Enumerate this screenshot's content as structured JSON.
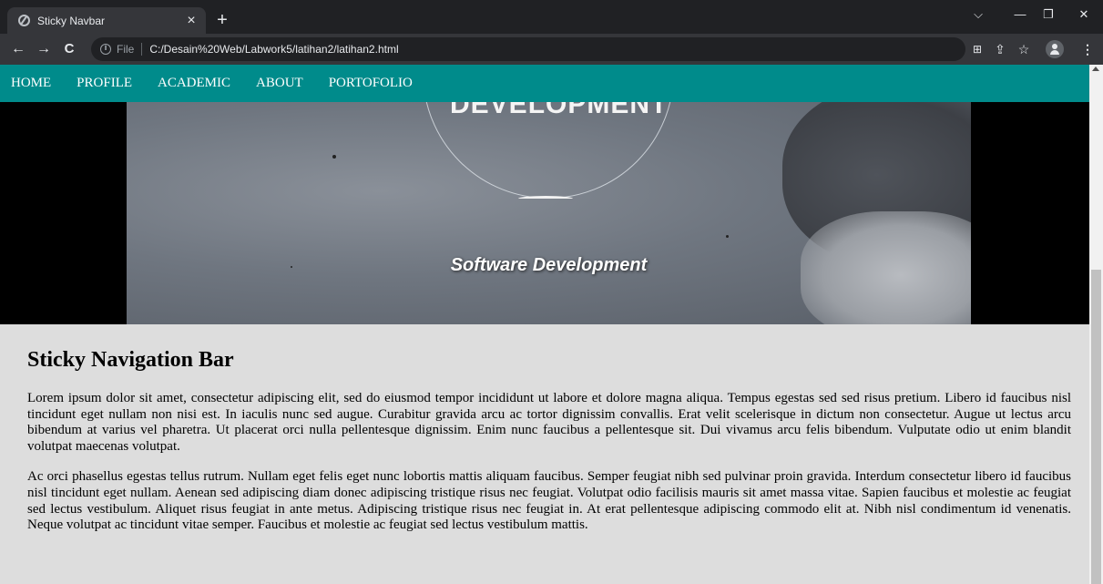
{
  "browser": {
    "tab_title": "Sticky Navbar",
    "tab_close": "×",
    "new_tab": "+",
    "window_controls": {
      "dropdown": "⌵",
      "minimize": "—",
      "restore": "❐",
      "close": "✕"
    },
    "toolbar": {
      "back": "←",
      "forward": "→",
      "reload": "C"
    },
    "address": {
      "scheme_label": "File",
      "url": "C:/Desain%20Web/Labwork5/latihan2/latihan2.html"
    }
  },
  "nav": {
    "items": [
      "HOME",
      "PROFILE",
      "ACADEMIC",
      "ABOUT",
      "PORTOFOLIO"
    ],
    "background": "#008b8b"
  },
  "hero": {
    "heading": "DEVELOPMENT",
    "caption": "Software Development"
  },
  "article": {
    "title": "Sticky Navigation Bar",
    "paragraphs": [
      "Lorem ipsum dolor sit amet, consectetur adipiscing elit, sed do eiusmod tempor incididunt ut labore et dolore magna aliqua. Tempus egestas sed sed risus pretium. Libero id faucibus nisl tincidunt eget nullam non nisi est. In iaculis nunc sed augue. Curabitur gravida arcu ac tortor dignissim convallis. Erat velit scelerisque in dictum non consectetur. Augue ut lectus arcu bibendum at varius vel pharetra. Ut placerat orci nulla pellentesque dignissim. Enim nunc faucibus a pellentesque sit. Dui vivamus arcu felis bibendum. Vulputate odio ut enim blandit volutpat maecenas volutpat.",
      "Ac orci phasellus egestas tellus rutrum. Nullam eget felis eget nunc lobortis mattis aliquam faucibus. Semper feugiat nibh sed pulvinar proin gravida. Interdum consectetur libero id faucibus nisl tincidunt eget nullam. Aenean sed adipiscing diam donec adipiscing tristique risus nec feugiat. Volutpat odio facilisis mauris sit amet massa vitae. Sapien faucibus et molestie ac feugiat sed lectus vestibulum. Aliquet risus feugiat in ante metus. Adipiscing tristique risus nec feugiat in. At erat pellentesque adipiscing commodo elit at. Nibh nisl condimentum id venenatis. Neque volutpat ac tincidunt vitae semper. Faucibus et molestie ac feugiat sed lectus vestibulum mattis."
    ]
  }
}
